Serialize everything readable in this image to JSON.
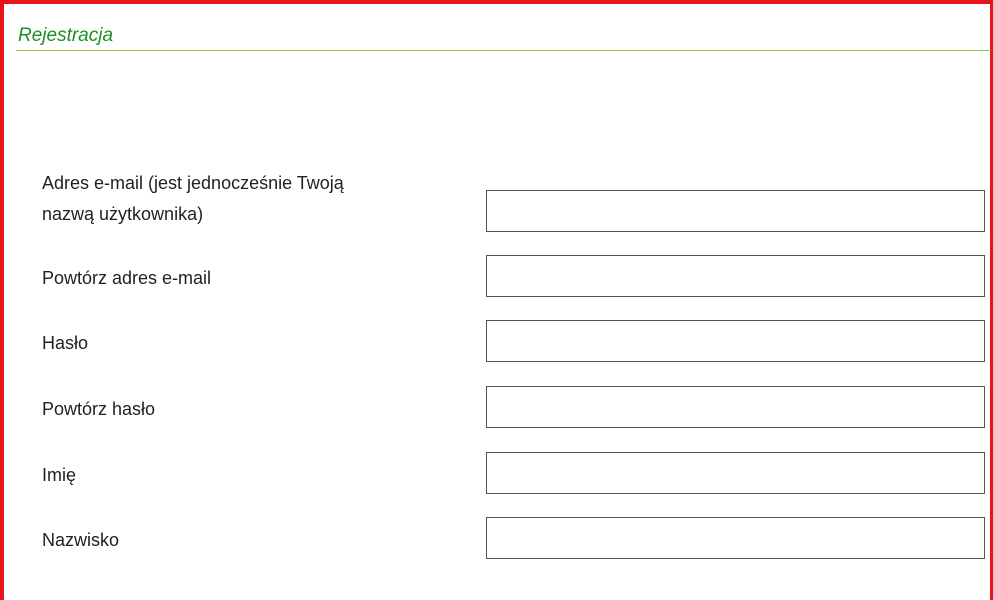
{
  "section": {
    "title": "Rejestracja"
  },
  "colors": {
    "frame_border": "#e8141b",
    "title": "#1f8f23",
    "rule": "#8cc63f",
    "input_border": "#555555"
  },
  "form": {
    "fields": [
      {
        "label_line1": "Adres e-mail (jest jednocześnie Twoją",
        "label_line2": "nazwą użytkownika)",
        "value": "",
        "placeholder": ""
      },
      {
        "label": "Powtórz adres e-mail",
        "value": "",
        "placeholder": ""
      },
      {
        "label": "Hasło",
        "value": "",
        "placeholder": ""
      },
      {
        "label": "Powtórz hasło",
        "value": "",
        "placeholder": ""
      },
      {
        "label": "Imię",
        "value": "",
        "placeholder": ""
      },
      {
        "label": "Nazwisko",
        "value": "",
        "placeholder": ""
      }
    ]
  }
}
